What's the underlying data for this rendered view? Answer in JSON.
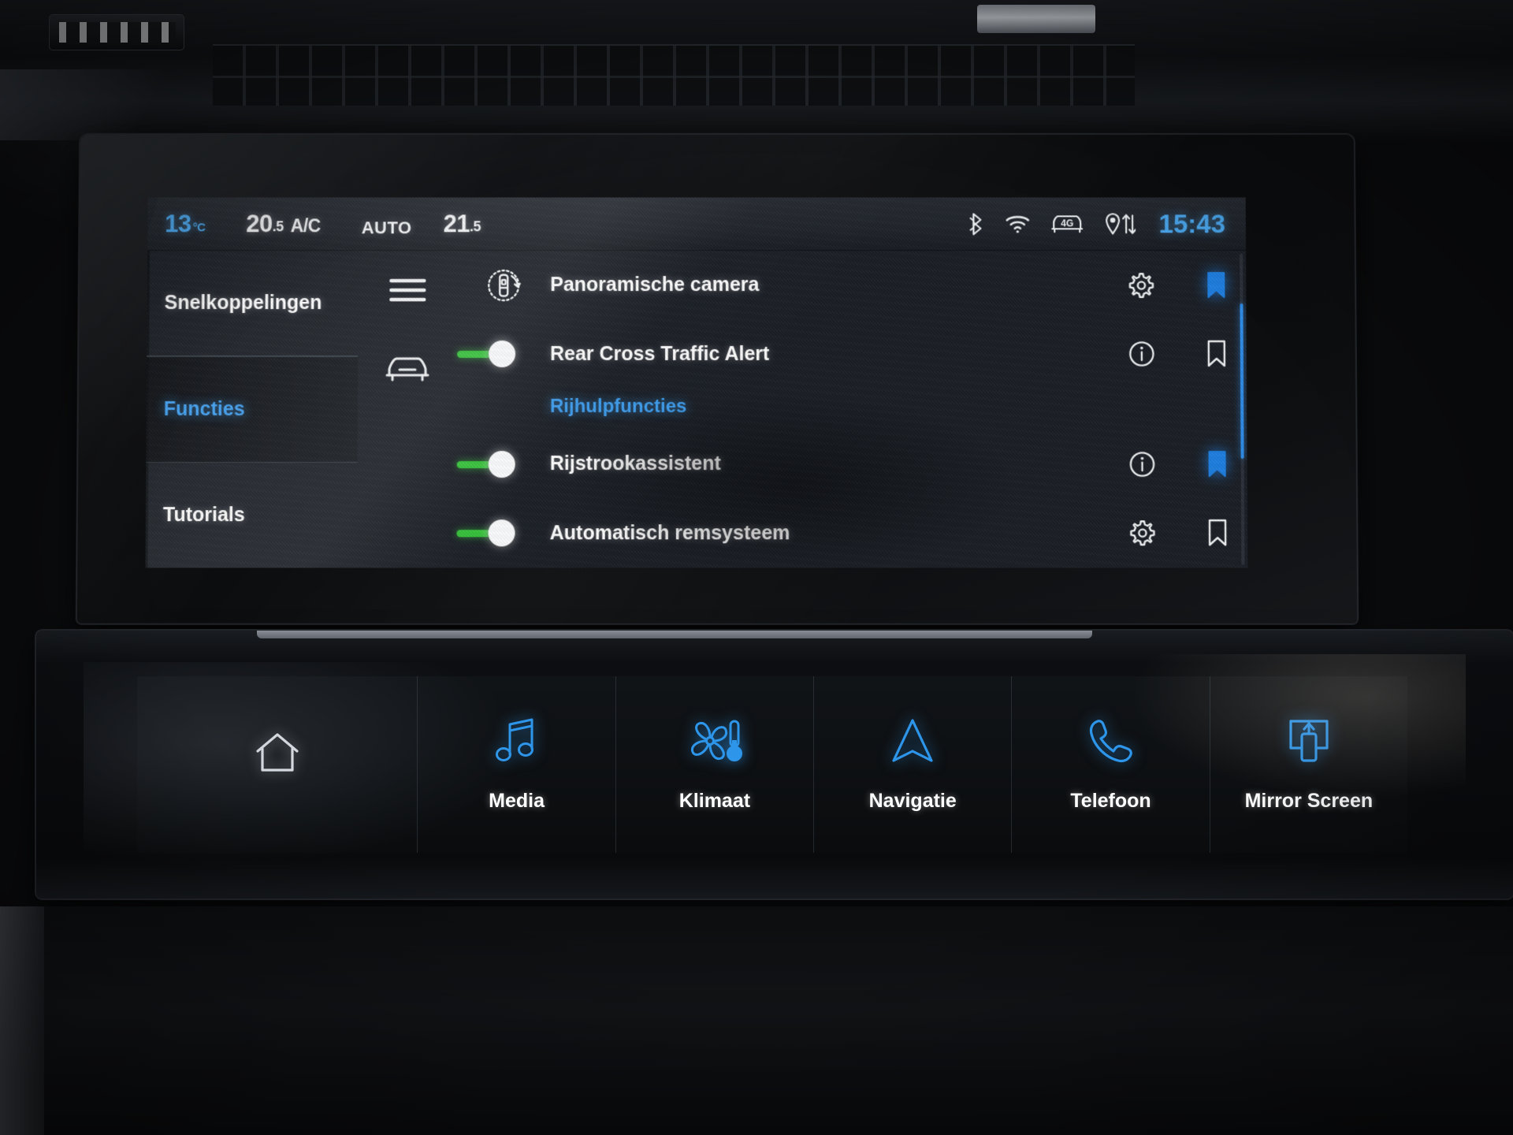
{
  "status_bar": {
    "outside_temp": "13",
    "outside_temp_unit": "°C",
    "driver_temp": "20",
    "driver_temp_decimal": ".5",
    "ac_label": "A/C",
    "auto_label": "AUTO",
    "passenger_temp": "21",
    "passenger_temp_decimal": ".5",
    "network_label": "4G",
    "clock": "15:43",
    "icons": [
      "bluetooth-icon",
      "wifi-icon",
      "car-4g-icon",
      "navigation-traffic-icon"
    ]
  },
  "sidebar": {
    "items": [
      {
        "label": "Snelkoppelingen",
        "active": false
      },
      {
        "label": "Functies",
        "active": true
      },
      {
        "label": "Tutorials",
        "active": false
      }
    ]
  },
  "left_icon_column": [
    {
      "name": "hamburger-menu-icon"
    },
    {
      "name": "car-front-icon"
    }
  ],
  "function_list": {
    "rows": [
      {
        "label": "Panoramische camera",
        "icon": "panoramic-camera-icon",
        "control": "icon",
        "toggle_on": null,
        "action_icon": "gear-icon",
        "bookmark": "filled"
      },
      {
        "label": "Rear Cross Traffic Alert",
        "icon": "car-front-icon",
        "control": "toggle",
        "toggle_on": true,
        "action_icon": "info-icon",
        "bookmark": "outline"
      }
    ],
    "section_header": "Rijhulpfuncties",
    "section_rows": [
      {
        "label": "Rijstrookassistent",
        "icon": null,
        "control": "toggle",
        "toggle_on": true,
        "action_icon": "info-icon",
        "bookmark": "filled"
      },
      {
        "label": "Automatisch remsysteem",
        "icon": null,
        "control": "toggle",
        "toggle_on": true,
        "action_icon": "gear-icon",
        "bookmark": "outline"
      }
    ]
  },
  "bottom_bar": {
    "items": [
      {
        "label": "",
        "icon": "home-icon",
        "accent": false
      },
      {
        "label": "Media",
        "icon": "music-note-icon",
        "accent": true
      },
      {
        "label": "Klimaat",
        "icon": "fan-thermometer-icon",
        "accent": true
      },
      {
        "label": "Navigatie",
        "icon": "navigation-arrow-icon",
        "accent": true
      },
      {
        "label": "Telefoon",
        "icon": "phone-handset-icon",
        "accent": true
      },
      {
        "label": "Mirror Screen",
        "icon": "mirror-screen-icon",
        "accent": true
      }
    ]
  },
  "colors": {
    "accent_blue": "#3f9ff0",
    "clock_blue": "#4aa8f0",
    "toggle_green": "#35c23a",
    "bookmark_blue": "#1f7fe0",
    "text_white": "#ffffff",
    "screen_bg": "#1b1f26"
  }
}
